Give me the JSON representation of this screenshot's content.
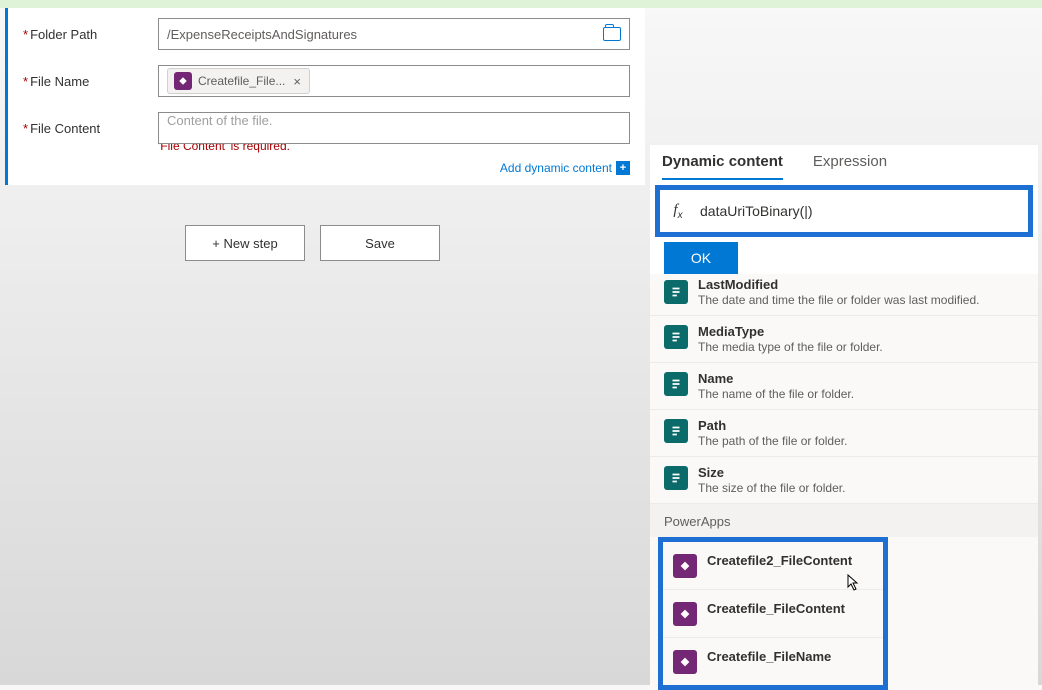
{
  "form": {
    "folder_label": "Folder Path",
    "folder_value": "/ExpenseReceiptsAndSignatures",
    "filename_label": "File Name",
    "filename_token": "Createfile_File...",
    "content_label": "File Content",
    "content_placeholder": "Content of the file.",
    "content_error": "'File Content' is required.",
    "add_dynamic": "Add dynamic content"
  },
  "buttons": {
    "new_step": "+ New step",
    "save": "Save"
  },
  "flyout": {
    "tab_dynamic": "Dynamic content",
    "tab_expression": "Expression",
    "formula": "dataUriToBinary(|)",
    "ok": "OK"
  },
  "dynamic_items": [
    {
      "name": "LastModified",
      "desc": "The date and time the file or folder was last modified."
    },
    {
      "name": "MediaType",
      "desc": "The media type of the file or folder."
    },
    {
      "name": "Name",
      "desc": "The name of the file or folder."
    },
    {
      "name": "Path",
      "desc": "The path of the file or folder."
    },
    {
      "name": "Size",
      "desc": "The size of the file or folder."
    }
  ],
  "section_powerapps": "PowerApps",
  "powerapps_items": [
    {
      "name": "Createfile2_FileContent"
    },
    {
      "name": "Createfile_FileContent"
    },
    {
      "name": "Createfile_FileName"
    }
  ]
}
